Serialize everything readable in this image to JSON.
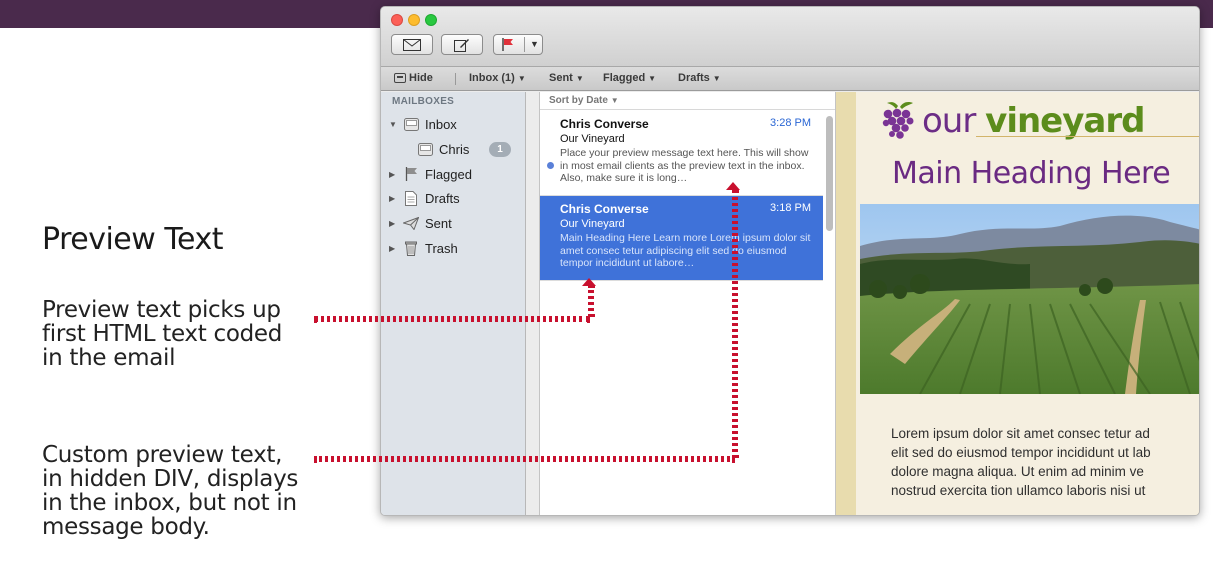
{
  "slide": {
    "heading": "Preview Text",
    "note1": "Preview text picks up\nfirst HTML text coded\nin the email",
    "note2": "Custom preview text,\nin hidden DIV, displays\nin the inbox, but not in\nmessage body."
  },
  "toolbar": {
    "get_mail_icon": "envelope-icon",
    "compose_icon": "compose-icon",
    "flag_icon": "flag-icon"
  },
  "favorites": {
    "hide": "Hide",
    "inbox": "Inbox (1)",
    "sent": "Sent",
    "flagged": "Flagged",
    "drafts": "Drafts"
  },
  "sidebar": {
    "heading": "MAILBOXES",
    "items": [
      {
        "label": "Inbox",
        "icon": "inbox-icon"
      },
      {
        "label": "Chris",
        "icon": "inbox-icon",
        "badge": "1"
      },
      {
        "label": "Flagged",
        "icon": "flag-icon"
      },
      {
        "label": "Drafts",
        "icon": "drafts-icon"
      },
      {
        "label": "Sent",
        "icon": "sent-icon"
      },
      {
        "label": "Trash",
        "icon": "trash-icon"
      }
    ]
  },
  "message_list": {
    "sort_label": "Sort by Date",
    "messages": [
      {
        "from": "Chris Converse",
        "time": "3:28 PM",
        "subject": "Our Vineyard",
        "preview": "Place your preview message text here. This will show in most email clients as the preview text in the inbox. Also, make sure it is long…"
      },
      {
        "from": "Chris Converse",
        "time": "3:18 PM",
        "subject": "Our Vineyard",
        "preview": "Main Heading Here Learn more Lorem ipsum dolor sit amet consec tetur adipiscing elit sed do eiusmod tempor incididunt ut labore…"
      }
    ]
  },
  "email_body": {
    "logo_light": "our",
    "logo_bold": "vineyard",
    "heading": "Main Heading Here",
    "paragraph_lines": [
      "Lorem ipsum dolor sit amet consec tetur ad",
      "elit sed do eiusmod tempor incididunt ut lab",
      "dolore magna aliqua. Ut enim ad minim ve",
      "nostrud exercita tion ullamco laboris nisi ut"
    ]
  },
  "colors": {
    "top_band": "#4a2a4c",
    "selection": "#3f72d9",
    "annotation_dots": "#c8102e",
    "heading_purple": "#6a2a82",
    "logo_green": "#5c8c1c"
  }
}
